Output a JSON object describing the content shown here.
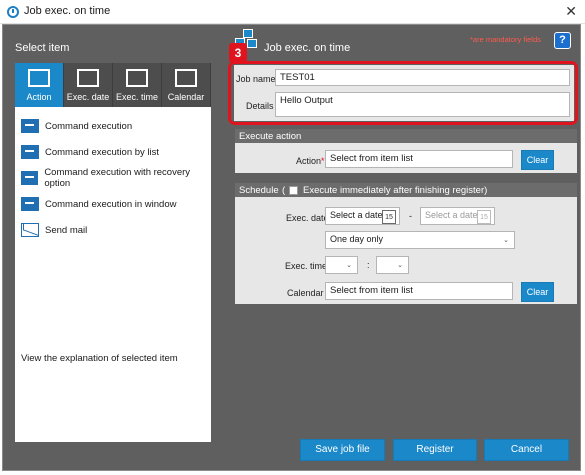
{
  "window": {
    "title": "Job exec. on time"
  },
  "left": {
    "section_title": "Select item",
    "tabs": [
      {
        "label": "Action"
      },
      {
        "label": "Exec. date"
      },
      {
        "label": "Exec. time"
      },
      {
        "label": "Calendar"
      }
    ],
    "items": [
      {
        "label": "Command execution"
      },
      {
        "label": "Command execution by list"
      },
      {
        "label": "Command execution with recovery option"
      },
      {
        "label": "Command execution in window"
      },
      {
        "label": "Send mail"
      }
    ],
    "description": "View the explanation of selected item"
  },
  "right": {
    "title": "Job exec. on time",
    "mandatory_note": "*are mandatory fields",
    "help": "?",
    "callout_number": "3",
    "job_name": {
      "label": "Job name",
      "value": "TEST01"
    },
    "details": {
      "label": "Details",
      "value": "Hello Output"
    },
    "execute_action": {
      "heading": "Execute action",
      "action_label": "Action",
      "action_value": "Select from item list",
      "clear_label": "Clear"
    },
    "schedule": {
      "heading": "Schedule",
      "paren_open": "(",
      "immediate_label": "Execute immediately after finishing register)",
      "exec_date_label": "Exec. date",
      "date_from_placeholder": "Select a date",
      "date_sep": "-",
      "date_to_placeholder": "Select a date",
      "cal_icon_text": "15",
      "frequency_value": "One day only",
      "exec_time_label": "Exec. time",
      "time_sep": ":",
      "calendar_label": "Calendar",
      "calendar_value": "Select from item list",
      "clear_label": "Clear"
    }
  },
  "footer": {
    "save": "Save job file",
    "register": "Register",
    "cancel": "Cancel"
  }
}
